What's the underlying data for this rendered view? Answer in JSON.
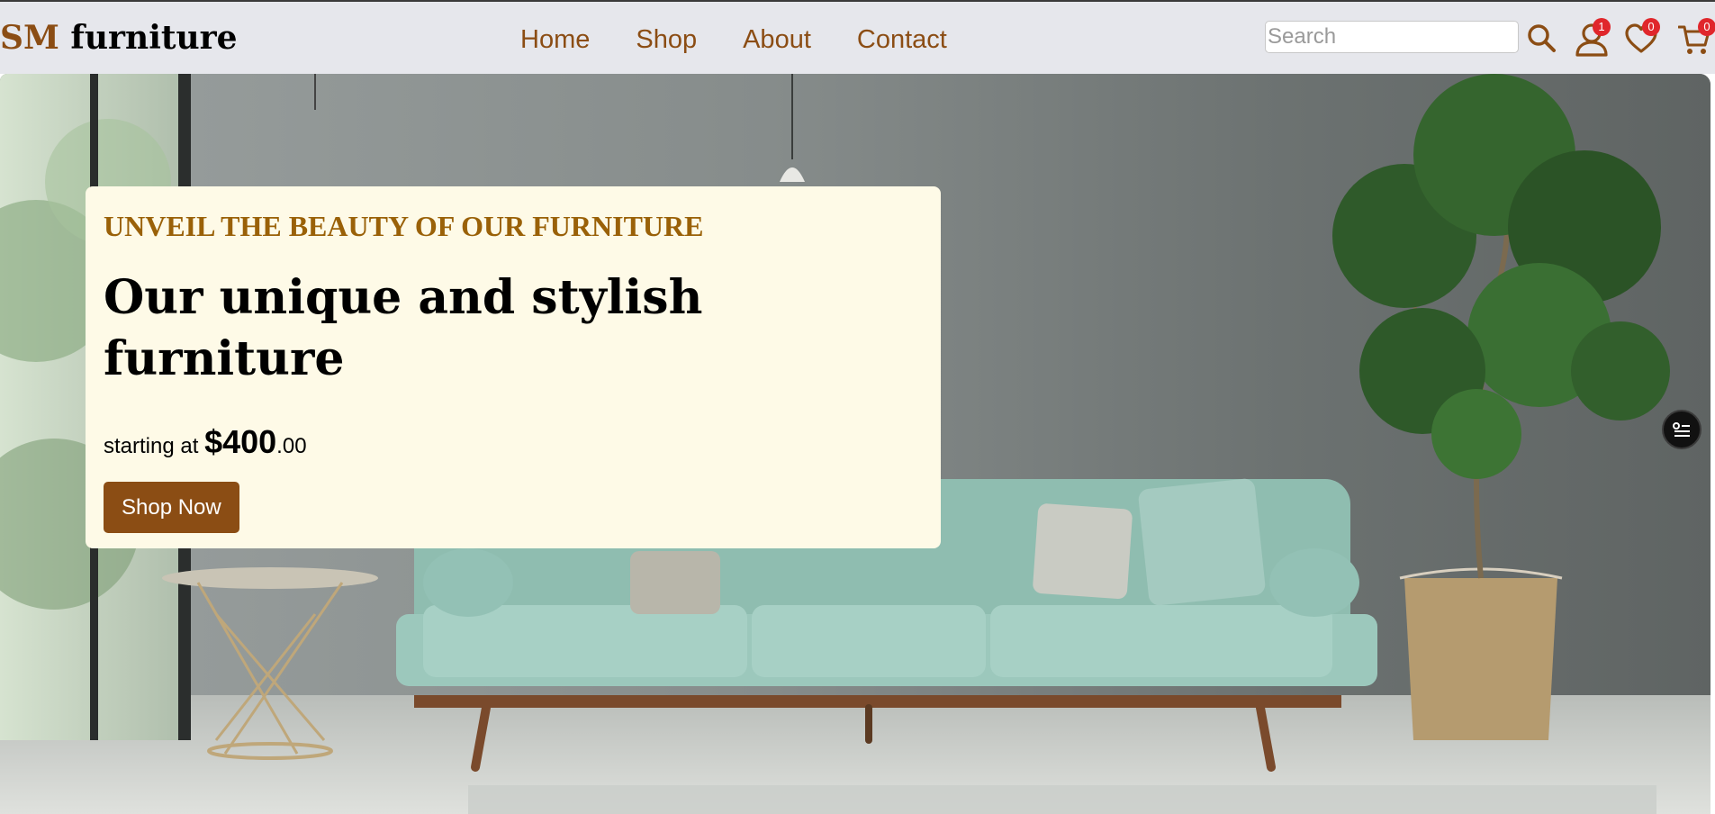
{
  "header": {
    "logo": {
      "accent": "SM",
      "rest": " furniture"
    },
    "nav": [
      {
        "label": "Home"
      },
      {
        "label": "Shop"
      },
      {
        "label": "About"
      },
      {
        "label": "Contact"
      }
    ],
    "search": {
      "placeholder": "Search",
      "value": ""
    },
    "icons": {
      "search": {
        "icon": "search-icon"
      },
      "account": {
        "icon": "user-icon",
        "badge": "1"
      },
      "wishlist": {
        "icon": "heart-icon",
        "badge": "0"
      },
      "cart": {
        "icon": "cart-icon",
        "badge": "0"
      }
    }
  },
  "hero": {
    "eyebrow": "UNVEIL THE BEAUTY OF OUR FURNITURE",
    "headline": "Our unique and stylish furniture",
    "price": {
      "prefix": "starting at ",
      "currency": "$",
      "amount": "400",
      "cents": ".00"
    },
    "cta": "Shop Now",
    "side_button_icon": "filter-list-icon"
  },
  "colors": {
    "brand": "#8b4d14",
    "eyebrow": "#9a6108",
    "header_bg": "#e6e7ec",
    "card_bg": "#fefae7",
    "badge": "#e0262b"
  }
}
